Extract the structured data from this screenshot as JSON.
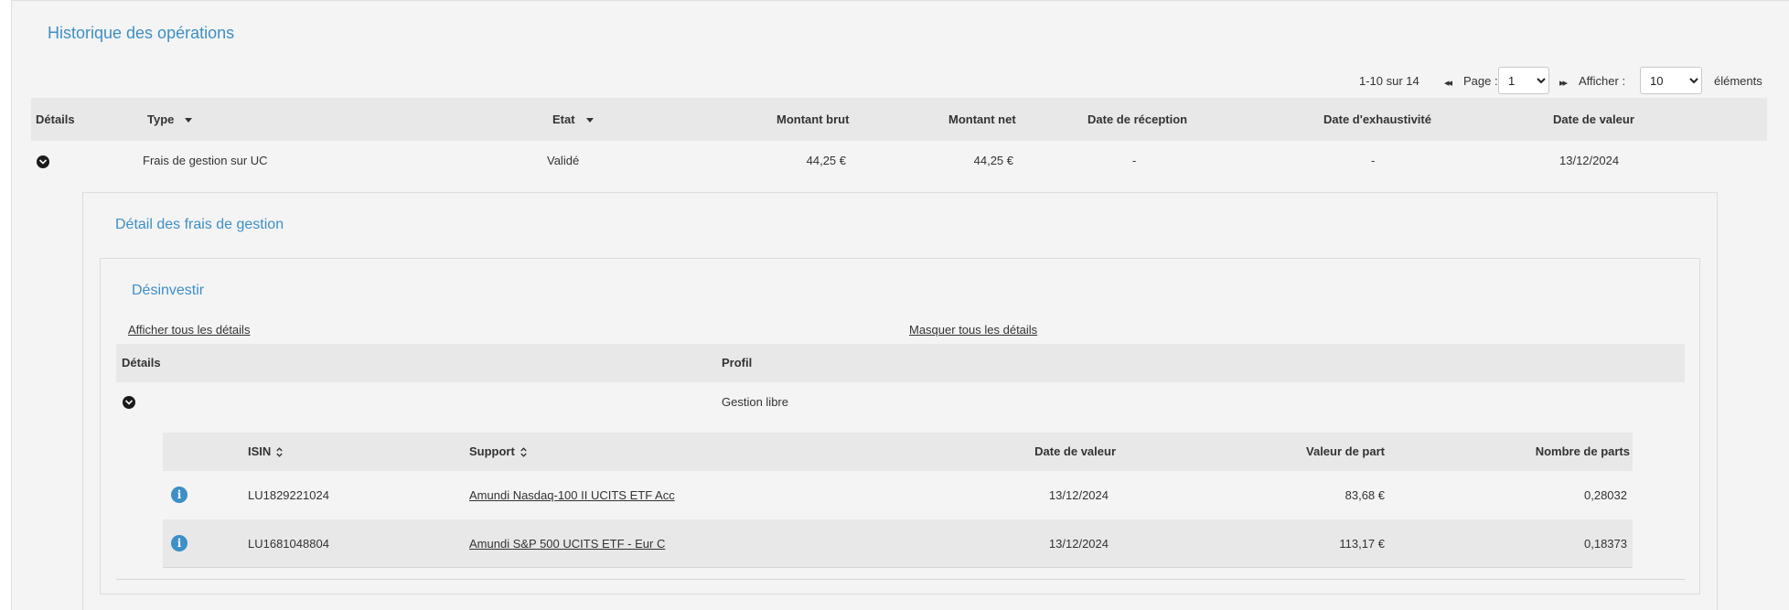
{
  "page": {
    "title": "Historique des opérations"
  },
  "pagination": {
    "count_text": "1-10 sur 14",
    "prev_icon": "double-chevron-left-icon",
    "page_label": "Page :",
    "page_value": "1",
    "next_icon": "double-chevron-right-icon",
    "show_label": "Afficher :",
    "show_value": "10",
    "items_label": "éléments"
  },
  "operations_table": {
    "headers": {
      "details": "Détails",
      "type": "Type",
      "etat": "Etat",
      "montant_brut": "Montant brut",
      "montant_net": "Montant net",
      "date_reception": "Date de réception",
      "date_exhaustivite": "Date d'exhaustivité",
      "date_valeur": "Date de valeur"
    },
    "rows": [
      {
        "type": "Frais de gestion sur UC",
        "etat": "Validé",
        "montant_brut": "44,25 €",
        "montant_net": "44,25 €",
        "date_reception": "-",
        "date_exhaustivite": "-",
        "date_valeur": "13/12/2024"
      }
    ]
  },
  "detail_panel": {
    "title": "Détail des frais de gestion",
    "section_title": "Désinvestir",
    "show_all_link": "Afficher tous les détails",
    "hide_all_link": "Masquer tous les détails",
    "profile_table": {
      "headers": {
        "details": "Détails",
        "profil": "Profil"
      },
      "rows": [
        {
          "profil": "Gestion libre"
        }
      ]
    },
    "support_table": {
      "headers": {
        "isin": "ISIN",
        "support": "Support",
        "date_valeur": "Date de valeur",
        "valeur_part": "Valeur de part",
        "nombre_parts": "Nombre de parts"
      },
      "rows": [
        {
          "isin": "LU1829221024",
          "support": "Amundi Nasdaq-100 II UCITS ETF Acc",
          "date_valeur": "13/12/2024",
          "valeur_part": "83,68 €",
          "nombre_parts": "0,28032"
        },
        {
          "isin": "LU1681048804",
          "support": "Amundi S&P 500 UCITS ETF - Eur C",
          "date_valeur": "13/12/2024",
          "valeur_part": "113,17 €",
          "nombre_parts": "0,18373"
        }
      ]
    }
  },
  "colors": {
    "accent_blue": "#3d8fc6",
    "header_gray": "#e8e8e8",
    "background": "#f4f4f4"
  }
}
